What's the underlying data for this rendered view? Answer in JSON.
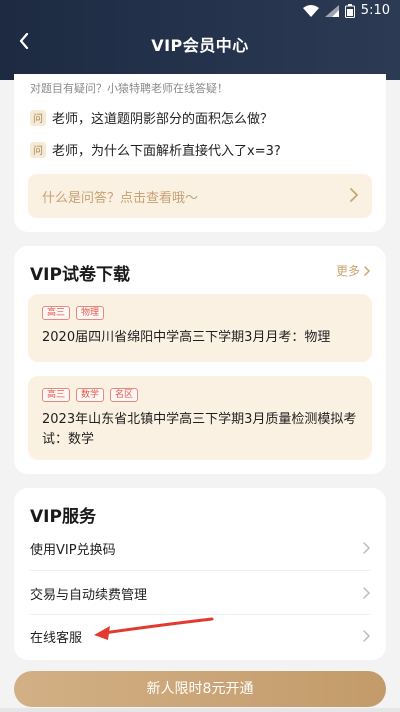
{
  "status": {
    "time": "5:10"
  },
  "header": {
    "title": "VIP会员中心"
  },
  "qa": {
    "hint": "对题目有疑问？小猿特聘老师在线答疑！",
    "tag": "问",
    "questions": [
      "老师，这道题阴影部分的面积怎么做？",
      "老师，为什么下面解析直接代入了x=3?"
    ],
    "link": "什么是问答？点击查看哦～"
  },
  "papers": {
    "title": "VIP试卷下载",
    "more": "更多",
    "items": [
      {
        "tags": [
          "高三",
          "物理"
        ],
        "title": "2020届四川省绵阳中学高三下学期3月月考：物理"
      },
      {
        "tags": [
          "高三",
          "数学",
          "名区"
        ],
        "title": "2023年山东省北镇中学高三下学期3月质量检测模拟考试：数学"
      }
    ]
  },
  "services": {
    "title": "VIP服务",
    "items": [
      "使用VIP兑换码",
      "交易与自动续费管理",
      "在线客服"
    ]
  },
  "cta": {
    "label": "新人限时8元开通"
  },
  "colors": {
    "header_bg": "#1d2a42",
    "accent": "#c9a56f",
    "tag_red": "#e05a4c",
    "annotation_arrow": "#e23a2f"
  }
}
